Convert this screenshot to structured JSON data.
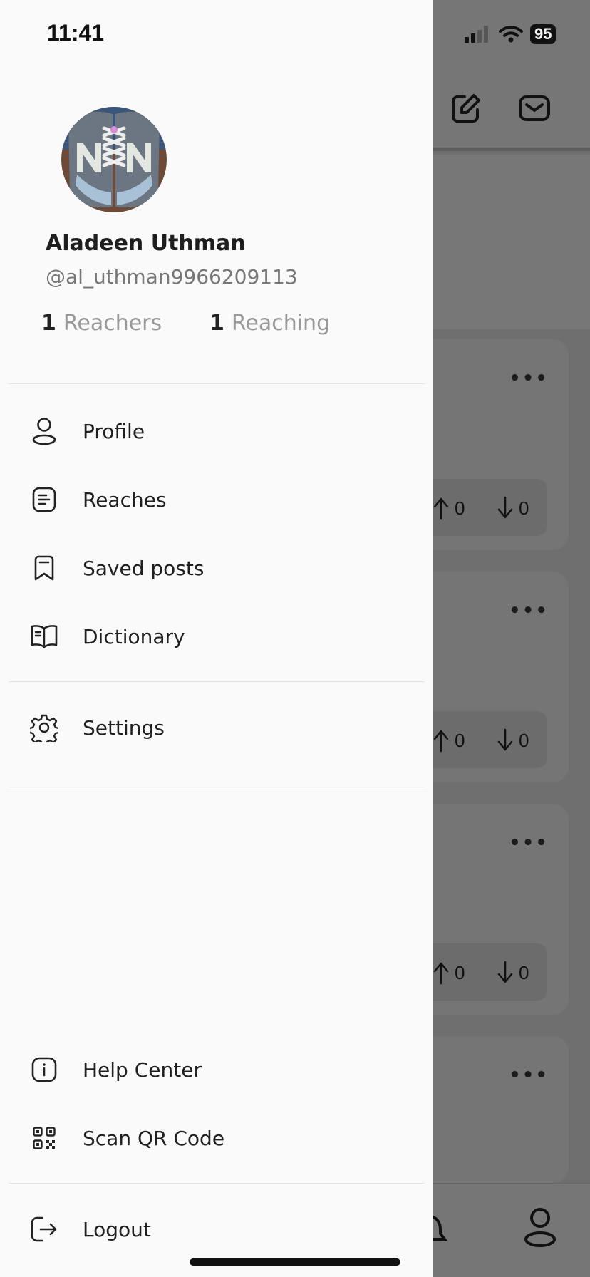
{
  "status_bar": {
    "time": "11:41",
    "battery": "95"
  },
  "profile": {
    "name": "Aladeen Uthman",
    "handle": "@al_uthman9966209113",
    "reachers_count": "1",
    "reachers_label": "Reachers",
    "reaching_count": "1",
    "reaching_label": "Reaching"
  },
  "menu": {
    "main": [
      {
        "label": "Profile",
        "icon": "user-icon"
      },
      {
        "label": "Reaches",
        "icon": "document-icon"
      },
      {
        "label": "Saved posts",
        "icon": "bookmark-icon"
      },
      {
        "label": "Dictionary",
        "icon": "book-icon"
      }
    ],
    "settings": {
      "label": "Settings",
      "icon": "gear-icon"
    },
    "help": {
      "label": "Help Center",
      "icon": "info-icon"
    },
    "scan": {
      "label": "Scan QR Code",
      "icon": "qr-code-icon"
    },
    "logout": {
      "label": "Logout",
      "icon": "logout-icon"
    }
  },
  "background_feed": {
    "cards": [
      {
        "upvotes": "0",
        "downvotes": "0"
      },
      {
        "upvotes": "0",
        "downvotes": "0"
      },
      {
        "upvotes": "0",
        "downvotes": "0"
      }
    ]
  }
}
